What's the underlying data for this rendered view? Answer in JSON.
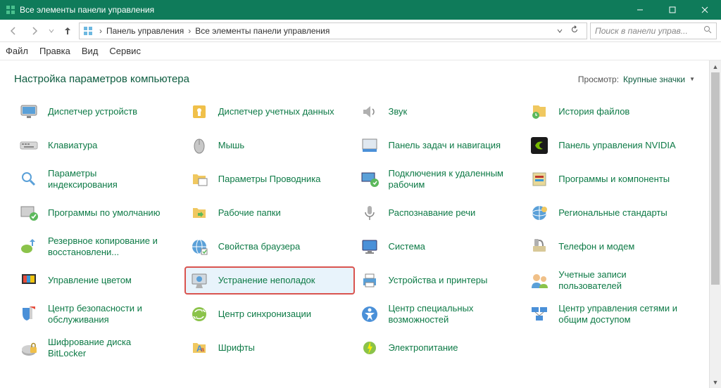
{
  "window": {
    "title": "Все элементы панели управления"
  },
  "breadcrumb": {
    "seg1": "Панель управления",
    "seg2": "Все элементы панели управления"
  },
  "search": {
    "placeholder": "Поиск в панели управ..."
  },
  "menu": {
    "file": "Файл",
    "edit": "Правка",
    "view": "Вид",
    "tools": "Сервис"
  },
  "page": {
    "heading": "Настройка параметров компьютера",
    "view_label": "Просмотр:",
    "view_value": "Крупные значки"
  },
  "items": [
    {
      "label": "Диспетчер устройств",
      "icon": "device-manager-icon"
    },
    {
      "label": "Диспетчер учетных данных",
      "icon": "credential-manager-icon"
    },
    {
      "label": "Звук",
      "icon": "sound-icon"
    },
    {
      "label": "История файлов",
      "icon": "file-history-icon"
    },
    {
      "label": "Клавиатура",
      "icon": "keyboard-icon"
    },
    {
      "label": "Мышь",
      "icon": "mouse-icon"
    },
    {
      "label": "Панель задач и навигация",
      "icon": "taskbar-icon"
    },
    {
      "label": "Панель управления NVIDIA",
      "icon": "nvidia-icon"
    },
    {
      "label": "Параметры индексирования",
      "icon": "indexing-icon"
    },
    {
      "label": "Параметры Проводника",
      "icon": "explorer-options-icon"
    },
    {
      "label": "Подключения к удаленным рабочим",
      "icon": "remoteapp-icon"
    },
    {
      "label": "Программы и компоненты",
      "icon": "programs-icon"
    },
    {
      "label": "Программы по умолчанию",
      "icon": "default-programs-icon"
    },
    {
      "label": "Рабочие папки",
      "icon": "work-folders-icon"
    },
    {
      "label": "Распознавание речи",
      "icon": "speech-icon"
    },
    {
      "label": "Региональные стандарты",
      "icon": "region-icon"
    },
    {
      "label": "Резервное копирование и восстановлени...",
      "icon": "backup-icon"
    },
    {
      "label": "Свойства браузера",
      "icon": "internet-options-icon"
    },
    {
      "label": "Система",
      "icon": "system-icon"
    },
    {
      "label": "Телефон и модем",
      "icon": "phone-modem-icon"
    },
    {
      "label": "Управление цветом",
      "icon": "color-management-icon"
    },
    {
      "label": "Устранение неполадок",
      "icon": "troubleshooting-icon",
      "highlight": true
    },
    {
      "label": "Устройства и принтеры",
      "icon": "devices-printers-icon"
    },
    {
      "label": "Учетные записи пользователей",
      "icon": "user-accounts-icon"
    },
    {
      "label": "Центр безопасности и обслуживания",
      "icon": "security-maintenance-icon"
    },
    {
      "label": "Центр синхронизации",
      "icon": "sync-center-icon"
    },
    {
      "label": "Центр специальных возможностей",
      "icon": "ease-of-access-icon"
    },
    {
      "label": "Центр управления сетями и общим доступом",
      "icon": "network-sharing-icon"
    },
    {
      "label": "Шифрование диска BitLocker",
      "icon": "bitlocker-icon"
    },
    {
      "label": "Шрифты",
      "icon": "fonts-icon"
    },
    {
      "label": "Электропитание",
      "icon": "power-options-icon"
    }
  ]
}
